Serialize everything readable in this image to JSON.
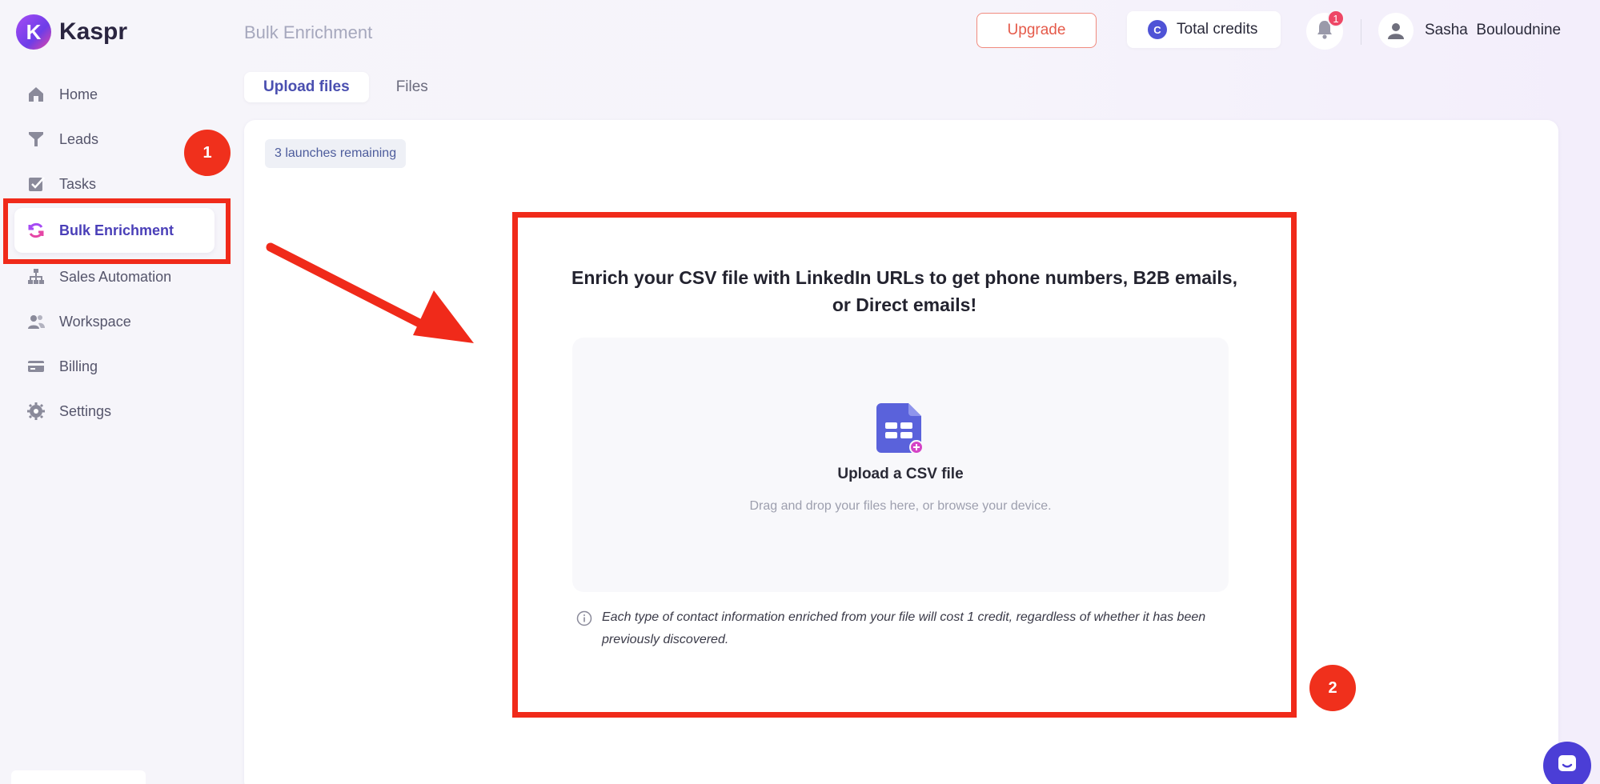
{
  "brand": {
    "name": "Kaspr",
    "mark": "K"
  },
  "header": {
    "page_title": "Bulk Enrichment",
    "upgrade_label": "Upgrade",
    "credits_label": "Total credits",
    "credits_badge": "C",
    "notifications_count": "1",
    "user_name": "Sasha  Bouloudnine"
  },
  "sidebar": {
    "items": [
      {
        "label": "Home",
        "icon": "home-icon"
      },
      {
        "label": "Leads",
        "icon": "funnel-icon"
      },
      {
        "label": "Tasks",
        "icon": "checkbox-icon"
      },
      {
        "label": "Bulk Enrichment",
        "icon": "sync-icon",
        "active": true
      },
      {
        "label": "Sales Automation",
        "icon": "hierarchy-icon"
      },
      {
        "label": "Workspace",
        "icon": "users-icon"
      },
      {
        "label": "Billing",
        "icon": "card-icon"
      },
      {
        "label": "Settings",
        "icon": "gear-icon"
      }
    ]
  },
  "tabs": [
    {
      "label": "Upload files",
      "active": true
    },
    {
      "label": "Files",
      "active": false
    }
  ],
  "main": {
    "launches_remaining": "3 launches remaining",
    "heading": "Enrich your CSV file with LinkedIn URLs to get phone numbers, B2B emails, or Direct emails!",
    "dropzone_title": "Upload a CSV file",
    "dropzone_subtitle": "Drag and drop your files here, or browse your device.",
    "info_text": "Each type of contact information enriched from your file will cost 1 credit, regardless of whether it has been previously discovered."
  },
  "annotations": {
    "step_1": "1",
    "step_2": "2",
    "highlight_color": "#f02a1a"
  },
  "colors": {
    "accent": "#4a3fb8",
    "brand": "#a64bf4",
    "alert": "#ee4766"
  }
}
